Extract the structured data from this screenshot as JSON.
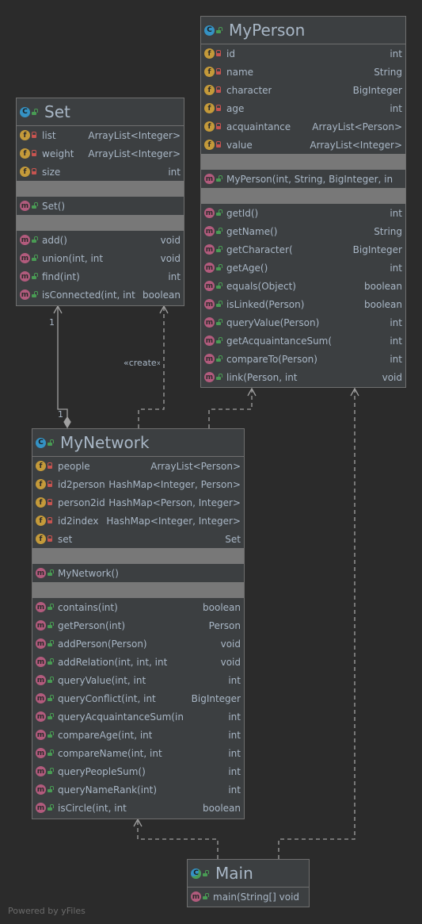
{
  "classes": {
    "myperson": {
      "name": "MyPerson",
      "fields": [
        {
          "name": "id",
          "type": "int"
        },
        {
          "name": "name",
          "type": "String"
        },
        {
          "name": "character",
          "type": "BigInteger"
        },
        {
          "name": "age",
          "type": "int"
        },
        {
          "name": "acquaintance",
          "type": "ArrayList<Person>"
        },
        {
          "name": "value",
          "type": "ArrayList<Integer>"
        }
      ],
      "constructors": [
        {
          "name": "MyPerson(int, String, BigInteger, in",
          "type": ""
        }
      ],
      "methods": [
        {
          "name": "getId()",
          "type": "int"
        },
        {
          "name": "getName()",
          "type": "String"
        },
        {
          "name": "getCharacter(",
          "type": "BigInteger"
        },
        {
          "name": "getAge()",
          "type": "int"
        },
        {
          "name": "equals(Object)",
          "type": "boolean"
        },
        {
          "name": "isLinked(Person)",
          "type": "boolean"
        },
        {
          "name": "queryValue(Person)",
          "type": "int"
        },
        {
          "name": "getAcquaintanceSum(",
          "type": "int"
        },
        {
          "name": "compareTo(Person)",
          "type": "int"
        },
        {
          "name": "link(Person, int",
          "type": "void"
        }
      ]
    },
    "set": {
      "name": "Set",
      "fields": [
        {
          "name": "list",
          "type": "ArrayList<Integer>"
        },
        {
          "name": "weight",
          "type": "ArrayList<Integer>"
        },
        {
          "name": "size",
          "type": "int"
        }
      ],
      "constructors": [
        {
          "name": "Set()",
          "type": ""
        }
      ],
      "methods": [
        {
          "name": "add()",
          "type": "void"
        },
        {
          "name": "union(int, int",
          "type": "void"
        },
        {
          "name": "find(int)",
          "type": "int"
        },
        {
          "name": "isConnected(int, int",
          "type": "boolean"
        }
      ]
    },
    "mynetwork": {
      "name": "MyNetwork",
      "fields": [
        {
          "name": "people",
          "type": "ArrayList<Person>"
        },
        {
          "name": "id2person",
          "type": "HashMap<Integer, Person>"
        },
        {
          "name": "person2id",
          "type": "HashMap<Person, Integer>"
        },
        {
          "name": "id2index",
          "type": "HashMap<Integer, Integer>"
        },
        {
          "name": "set",
          "type": "Set"
        }
      ],
      "constructors": [
        {
          "name": "MyNetwork()",
          "type": ""
        }
      ],
      "methods": [
        {
          "name": "contains(int)",
          "type": "boolean"
        },
        {
          "name": "getPerson(int)",
          "type": "Person"
        },
        {
          "name": "addPerson(Person)",
          "type": "void"
        },
        {
          "name": "addRelation(int, int, int",
          "type": "void"
        },
        {
          "name": "queryValue(int, int",
          "type": "int"
        },
        {
          "name": "queryConflict(int, int",
          "type": "BigInteger"
        },
        {
          "name": "queryAcquaintanceSum(in",
          "type": "int"
        },
        {
          "name": "compareAge(int, int",
          "type": "int"
        },
        {
          "name": "compareName(int, int",
          "type": "int"
        },
        {
          "name": "queryPeopleSum()",
          "type": "int"
        },
        {
          "name": "queryNameRank(int)",
          "type": "int"
        },
        {
          "name": "isCircle(int, int",
          "type": "boolean"
        }
      ]
    },
    "main": {
      "name": "Main",
      "methods": [
        {
          "name": "main(String[] void",
          "type": ""
        }
      ]
    }
  },
  "edge_labels": {
    "one_a": "1",
    "one_b": "1",
    "creates": "«create»"
  },
  "icons": {
    "class": "C",
    "field": "f",
    "method": "m"
  },
  "footer": "Powered by yFiles"
}
